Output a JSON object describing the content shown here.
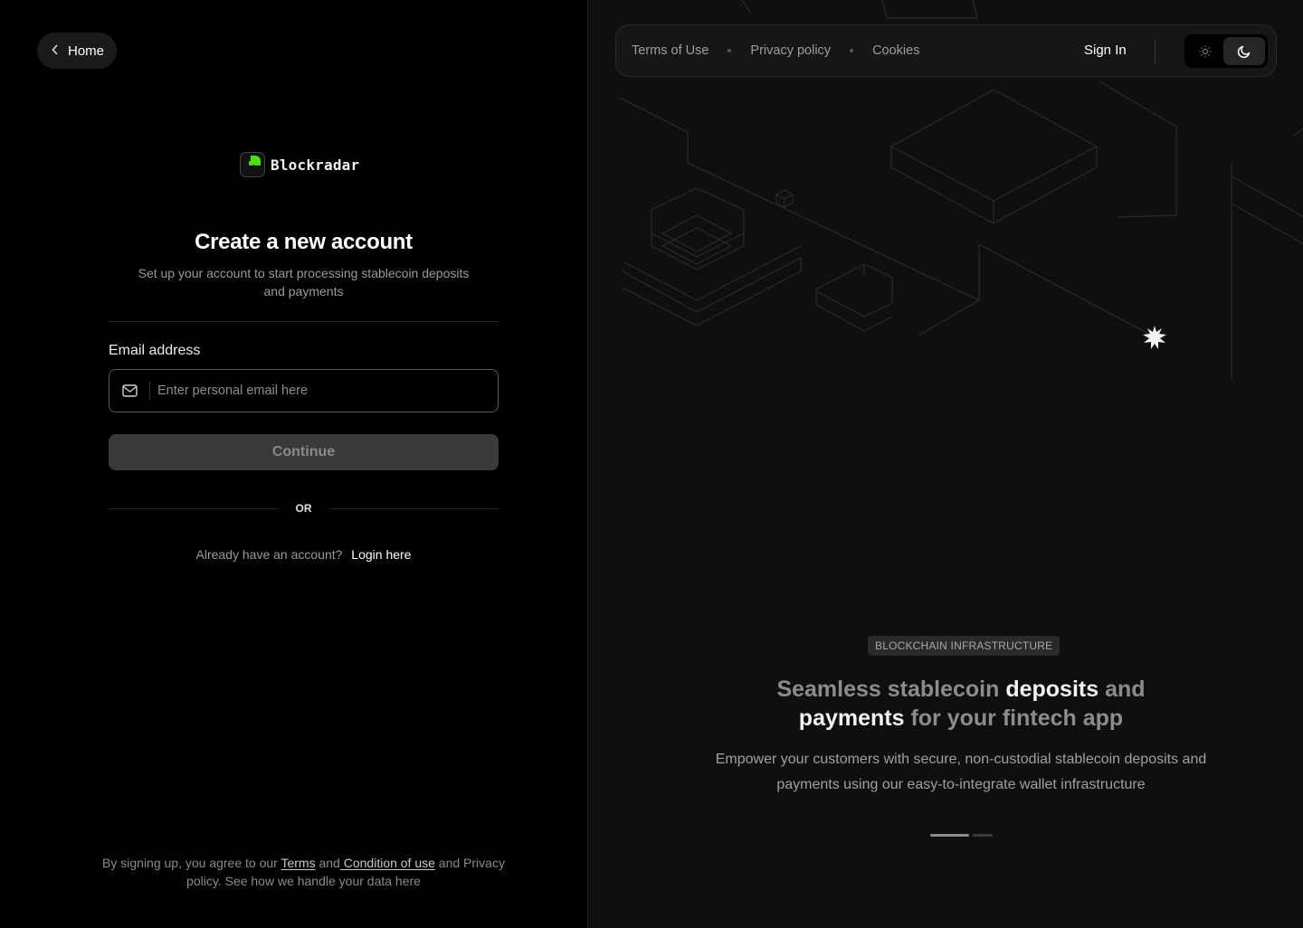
{
  "left": {
    "home_label": "Home",
    "brand_name": "Blockradar",
    "title": "Create a new account",
    "subtitle": "Set up your account to start processing stablecoin deposits and payments",
    "email_label": "Email address",
    "email_placeholder": "Enter personal email here",
    "email_value": "",
    "continue_label": "Continue",
    "or_label": "OR",
    "login_prompt": "Already have an account?",
    "login_link": "Login here",
    "legal": {
      "prefix": "By signing up, you agree to our ",
      "terms": "Terms",
      "and": " and",
      "condition": " Condition of use",
      "suffix": " and Privacy policy. See how we handle your data here"
    }
  },
  "right": {
    "nav": {
      "terms": "Terms of Use",
      "privacy": "Privacy policy",
      "cookies": "Cookies",
      "signin": "Sign In",
      "theme_active": "dark"
    },
    "badge": "BLOCKCHAIN INFRASTRUCTURE",
    "headline": {
      "p1": "Seamless stablecoin ",
      "h1": "deposits",
      "p2": " and ",
      "h2": "payments",
      "p3": " for your  fintech app"
    },
    "description": "Empower your customers with secure, non-custodial stablecoin deposits and payments using our easy-to-integrate wallet infrastructure",
    "carousel": {
      "total": 2,
      "active": 1
    }
  },
  "colors": {
    "brand_green": "#48e312",
    "background": "#000000",
    "panel": "#0f0f0f"
  },
  "icons": [
    "chevron-left-icon",
    "brand-logo-icon",
    "mail-icon",
    "sun-icon",
    "moon-icon",
    "sparkle-icon"
  ]
}
